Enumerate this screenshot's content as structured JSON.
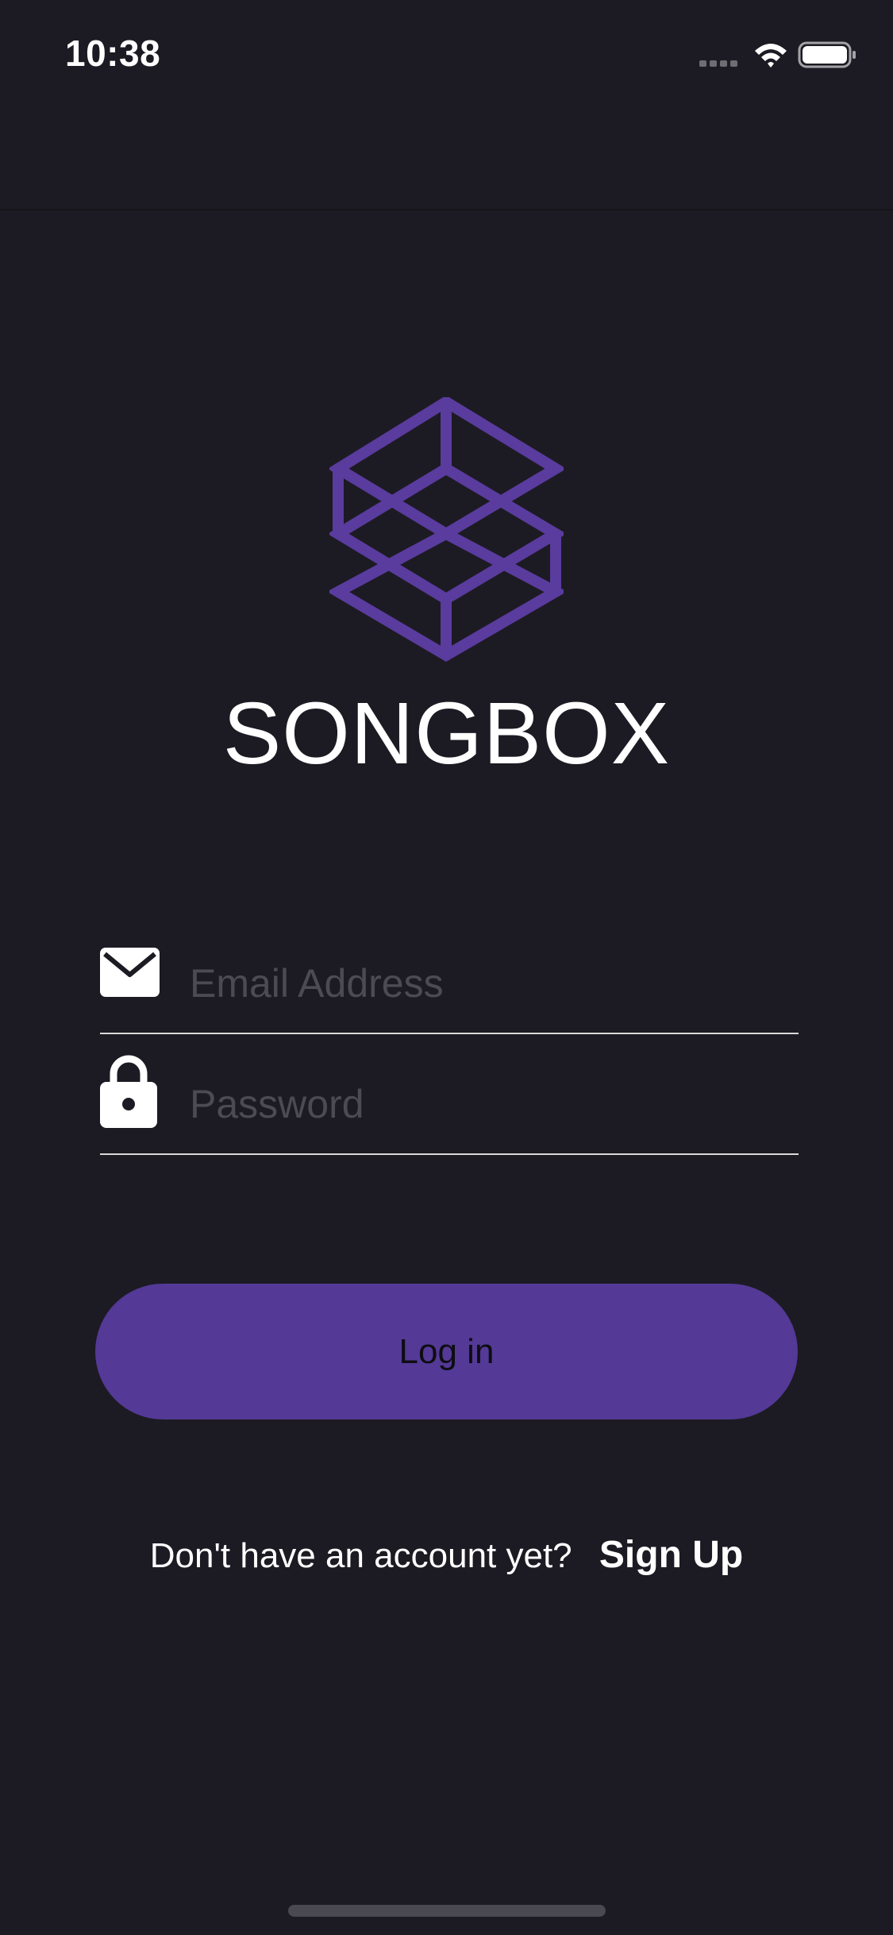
{
  "status_bar": {
    "time": "10:38",
    "signal_icon": "cellular-signal-icon",
    "wifi_icon": "wifi-icon",
    "battery_icon": "battery-icon"
  },
  "brand": {
    "logo_icon": "songbox-logo-icon",
    "name": "SONGBOX",
    "accent_color": "#5a3b9e"
  },
  "login_form": {
    "email": {
      "icon": "envelope-icon",
      "placeholder": "Email Address",
      "value": ""
    },
    "password": {
      "icon": "lock-icon",
      "placeholder": "Password",
      "value": ""
    },
    "login_button": {
      "label": "Log in",
      "color": "#543997"
    }
  },
  "signup": {
    "prompt": "Don't have an account yet?",
    "link_label": "Sign Up"
  },
  "theme": {
    "background": "#1c1b23"
  }
}
